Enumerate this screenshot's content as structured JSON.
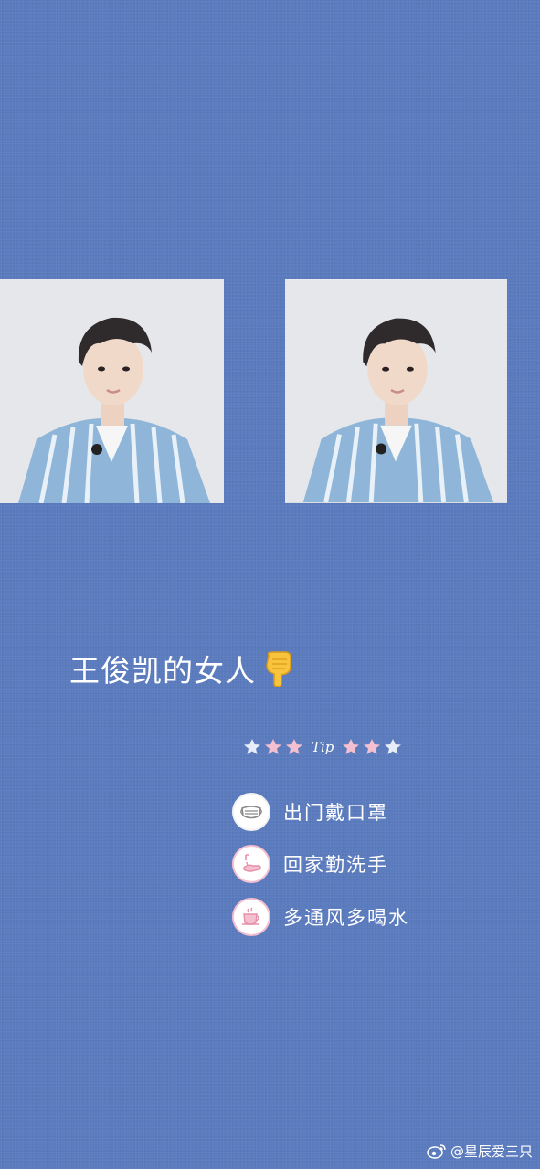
{
  "headline": {
    "text": "王俊凯的女人",
    "emoji_icon": "pointing-down-hand-icon"
  },
  "tip_banner": {
    "label": "Tip",
    "star_colors": [
      "#e8eef9",
      "#f4bfcf",
      "#f4bfcf",
      "#f4bfcf",
      "#f4bfcf",
      "#e8eef9"
    ]
  },
  "reminders": [
    {
      "icon": "face-mask-icon",
      "text": "出门戴口罩"
    },
    {
      "icon": "hand-wash-icon",
      "text": "回家勤洗手"
    },
    {
      "icon": "water-cup-icon",
      "text": "多通风多喝水"
    }
  ],
  "photos": [
    {
      "icon": "portrait-photo"
    },
    {
      "icon": "portrait-photo"
    }
  ],
  "watermark": {
    "icon": "weibo-icon",
    "text": "@星辰爱三只"
  },
  "colors": {
    "background": "#5b7bbf",
    "accent_pink": "#f4bfcf",
    "text": "#ffffff"
  }
}
